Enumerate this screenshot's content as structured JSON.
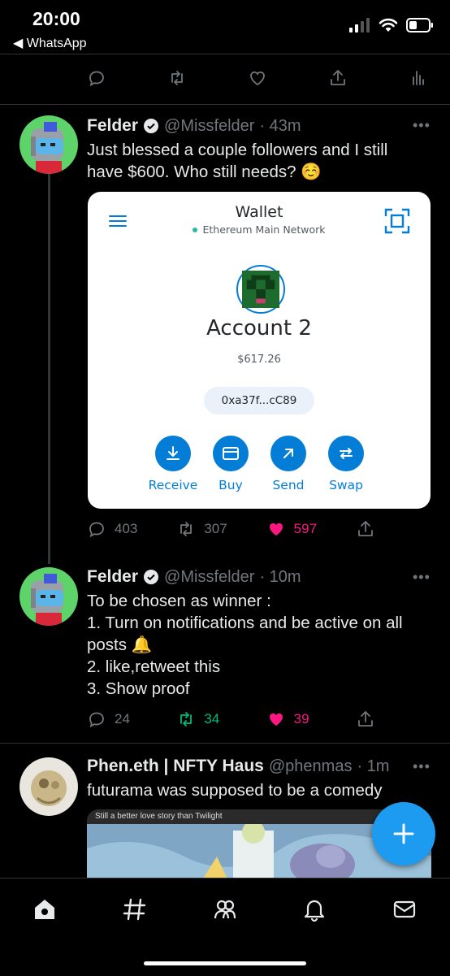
{
  "status_bar": {
    "time": "20:00",
    "back_label": "◀ WhatsApp"
  },
  "colors": {
    "like": "#f91880",
    "retweet": "#00ba7c",
    "accent": "#1d9bf0",
    "metamask_blue": "#037dd6"
  },
  "tweets": [
    {
      "name": "Felder",
      "handle": "@Missfelder",
      "time": "· 43m",
      "text": "Just blessed a couple followers and I still have $600. Who still needs? ☺️",
      "wallet": {
        "title": "Wallet",
        "network": "Ethereum Main Network",
        "account_name": "Account 2",
        "fiat_balance": "$617.26",
        "address": "0xa37f...cC89",
        "buttons": [
          "Receive",
          "Buy",
          "Send",
          "Swap"
        ]
      },
      "replies": "403",
      "retweets": "307",
      "likes": "597"
    },
    {
      "name": "Felder",
      "handle": "@Missfelder",
      "time": "· 10m",
      "text": "To be chosen as winner :\n1. Turn on notifications and be active on all posts 🔔\n2. like,retweet this\n3. Show proof",
      "replies": "24",
      "retweets": "34",
      "likes": "39"
    },
    {
      "name": "Phen.eth | NFTY Haus",
      "handle": "@phenmas",
      "time": "· 1m",
      "text": "futurama was supposed to be a comedy",
      "media_caption": "Still a better love story than Twilight"
    }
  ]
}
